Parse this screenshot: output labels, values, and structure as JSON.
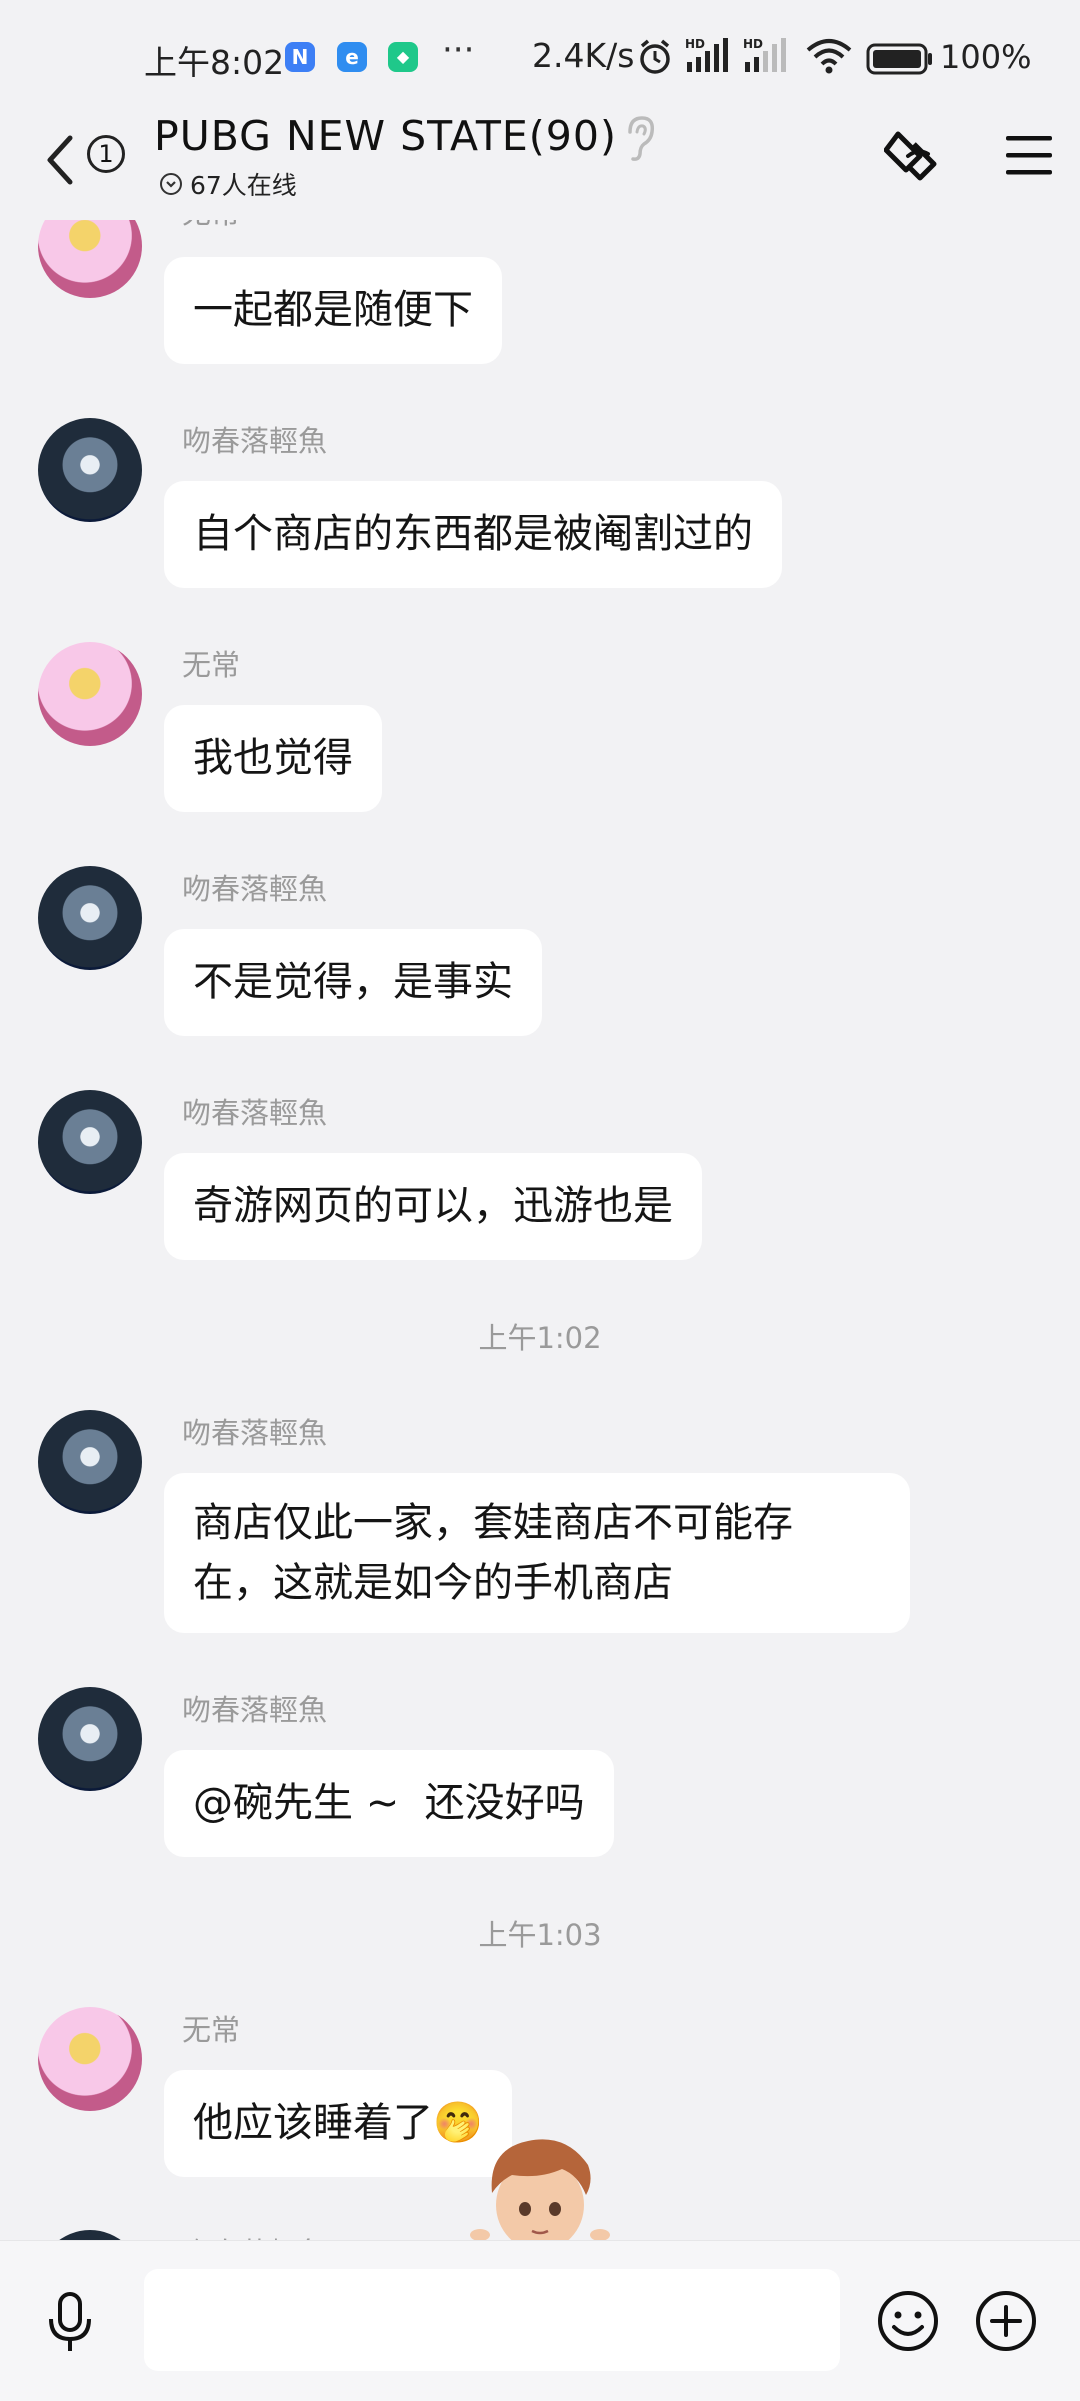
{
  "status_bar": {
    "time": "上午8:02",
    "app_icons": [
      {
        "name": "n-app-icon",
        "glyph": "N",
        "color": "#3d7ff5"
      },
      {
        "name": "edge-app-icon",
        "glyph": "e",
        "color": "#2f8df0"
      },
      {
        "name": "shield-app-icon",
        "glyph": "◆",
        "color": "#1fc88a"
      }
    ],
    "more": "···",
    "speed": "2.4K/s",
    "hd1": "HD",
    "hd2": "HD",
    "battery": "100%"
  },
  "header": {
    "unread_count": "1",
    "title": "PUBG  NEW STATE(90)",
    "online": "67人在线"
  },
  "messages": [
    {
      "type": "msg",
      "sender": "无常",
      "avatar": "pink",
      "text": "一起都是随便下"
    },
    {
      "type": "msg",
      "sender": "吻春落輕魚",
      "avatar": "blue",
      "text": "自个商店的东西都是被阉割过的"
    },
    {
      "type": "msg",
      "sender": "无常",
      "avatar": "pink",
      "text": "我也觉得"
    },
    {
      "type": "msg",
      "sender": "吻春落輕魚",
      "avatar": "blue",
      "text": "不是觉得，是事实"
    },
    {
      "type": "msg",
      "sender": "吻春落輕魚",
      "avatar": "blue",
      "text": "奇游网页的可以，迅游也是"
    },
    {
      "type": "time",
      "text": "上午1:02"
    },
    {
      "type": "msg",
      "sender": "吻春落輕魚",
      "avatar": "blue",
      "lines": [
        "商店仅此一家，套娃商店不可能存",
        "在，这就是如今的手机商店"
      ]
    },
    {
      "type": "msg",
      "sender": "吻春落輕魚",
      "avatar": "blue",
      "text": "@碗先生 ~  还没好吗"
    },
    {
      "type": "time",
      "text": "上午1:03"
    },
    {
      "type": "msg",
      "sender": "无常",
      "avatar": "pink",
      "text": "他应该睡着了🤭"
    },
    {
      "type": "msg",
      "sender": "吻春落輕魚",
      "avatar": "blue",
      "text": ""
    }
  ],
  "input_bar": {
    "placeholder": ""
  },
  "colors": {
    "background": "#f2f2f4",
    "bubble": "#ffffff",
    "meta_text": "#9a9a9a"
  }
}
